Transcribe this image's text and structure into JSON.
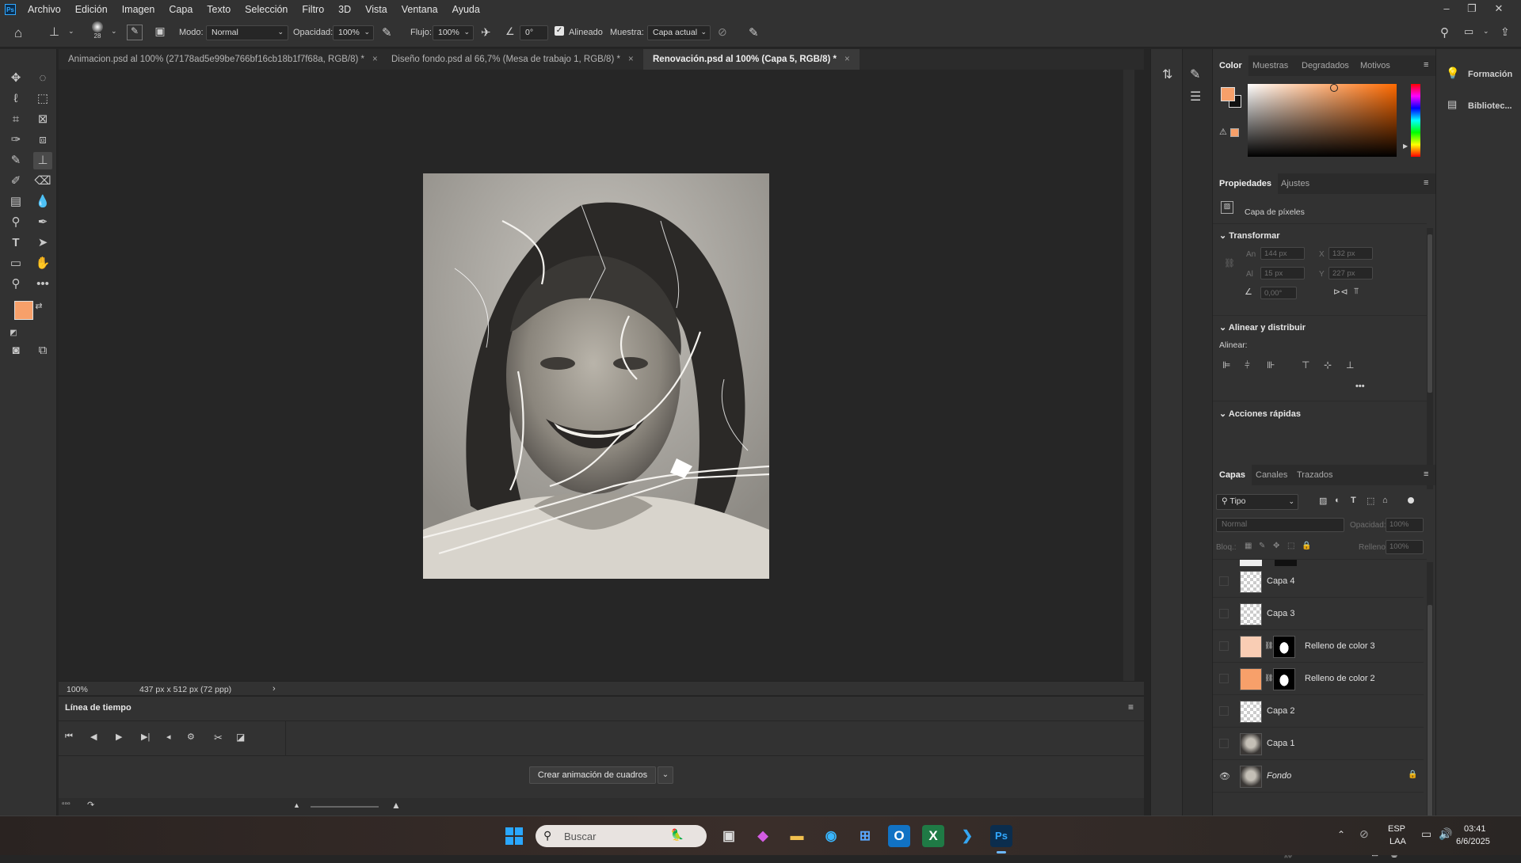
{
  "colors": {
    "foreground": "#f7a06a",
    "background": "#111111",
    "accent": "#31a8ff"
  },
  "app": {
    "logo": "Ps"
  },
  "menu": [
    "Archivo",
    "Edición",
    "Imagen",
    "Capa",
    "Texto",
    "Selección",
    "Filtro",
    "3D",
    "Vista",
    "Ventana",
    "Ayuda"
  ],
  "options": {
    "brush_size": "28",
    "mode_label": "Modo:",
    "mode_value": "Normal",
    "opacity_label": "Opacidad:",
    "opacity_value": "100%",
    "flow_label": "Flujo:",
    "flow_value": "100%",
    "angle_value": "0°",
    "aligned_label": "Alineado",
    "sample_label": "Muestra:",
    "sample_value": "Capa actual"
  },
  "tabs": [
    {
      "label": "Animacion.psd al 100% (27178ad5e99be766bf16cb18b1f7f68a, RGB/8) *",
      "close": "×"
    },
    {
      "label": "Diseño fondo.psd al 66,7% (Mesa de trabajo 1, RGB/8) *",
      "close": "×"
    },
    {
      "label": "Renovación.psd al 100% (Capa 5, RGB/8) *",
      "close": "×"
    }
  ],
  "status": {
    "zoom": "100%",
    "doc_info": "437 px x 512 px (72 ppp)",
    "arrow": "›"
  },
  "timeline": {
    "title": "Línea de tiempo",
    "create_button": "Crear animación de cuadros"
  },
  "color_panel": {
    "tabs": [
      "Color",
      "Muestras",
      "Degradados",
      "Motivos"
    ]
  },
  "properties": {
    "tabs": [
      "Propiedades",
      "Ajustes"
    ],
    "layer_type": "Capa de píxeles",
    "transform_title": "Transformar",
    "w_label": "An",
    "w_value": "144 px",
    "x_label": "X",
    "x_value": "132 px",
    "h_label": "Al",
    "h_value": "15 px",
    "y_label": "Y",
    "y_value": "227 px",
    "angle_value": "0,00°",
    "align_title": "Alinear y distribuir",
    "align_label": "Alinear:",
    "more": "•••",
    "quick_title": "Acciones rápidas"
  },
  "layers_panel": {
    "tabs": [
      "Capas",
      "Canales",
      "Trazados"
    ],
    "filter_label": "Tipo",
    "blend_mode": "Normal",
    "opacity_label": "Opacidad:",
    "opacity_value": "100%",
    "lock_label": "Bloq.:",
    "fill_label": "Relleno:",
    "fill_value": "100%",
    "layers": [
      {
        "name": "Capa 4",
        "kind": "empty"
      },
      {
        "name": "Capa 3",
        "kind": "empty"
      },
      {
        "name": "Relleno de color 3",
        "kind": "fill",
        "fill": "#f9cdb4"
      },
      {
        "name": "Relleno de color 2",
        "kind": "fill",
        "fill": "#f7a06a"
      },
      {
        "name": "Capa 2",
        "kind": "empty"
      },
      {
        "name": "Capa 1",
        "kind": "photo"
      },
      {
        "name": "Fondo",
        "kind": "photo",
        "locked": true,
        "visible": true
      }
    ]
  },
  "right_dock": {
    "learn": "Formación",
    "libraries": "Bibliotec..."
  },
  "taskbar": {
    "search_placeholder": "Buscar",
    "lang_top": "ESP",
    "lang_bottom": "LAA",
    "time": "03:41",
    "date": "6/6/2025"
  }
}
